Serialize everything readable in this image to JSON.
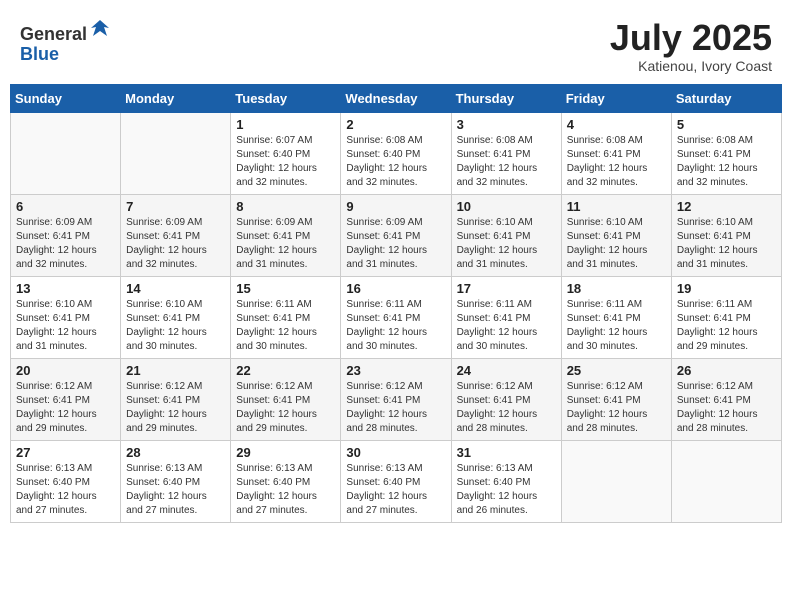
{
  "header": {
    "logo_general": "General",
    "logo_blue": "Blue",
    "month_title": "July 2025",
    "location": "Katienou, Ivory Coast"
  },
  "weekdays": [
    "Sunday",
    "Monday",
    "Tuesday",
    "Wednesday",
    "Thursday",
    "Friday",
    "Saturday"
  ],
  "weeks": [
    [
      {
        "day": "",
        "info": ""
      },
      {
        "day": "",
        "info": ""
      },
      {
        "day": "1",
        "info": "Sunrise: 6:07 AM\nSunset: 6:40 PM\nDaylight: 12 hours and 32 minutes."
      },
      {
        "day": "2",
        "info": "Sunrise: 6:08 AM\nSunset: 6:40 PM\nDaylight: 12 hours and 32 minutes."
      },
      {
        "day": "3",
        "info": "Sunrise: 6:08 AM\nSunset: 6:41 PM\nDaylight: 12 hours and 32 minutes."
      },
      {
        "day": "4",
        "info": "Sunrise: 6:08 AM\nSunset: 6:41 PM\nDaylight: 12 hours and 32 minutes."
      },
      {
        "day": "5",
        "info": "Sunrise: 6:08 AM\nSunset: 6:41 PM\nDaylight: 12 hours and 32 minutes."
      }
    ],
    [
      {
        "day": "6",
        "info": "Sunrise: 6:09 AM\nSunset: 6:41 PM\nDaylight: 12 hours and 32 minutes."
      },
      {
        "day": "7",
        "info": "Sunrise: 6:09 AM\nSunset: 6:41 PM\nDaylight: 12 hours and 32 minutes."
      },
      {
        "day": "8",
        "info": "Sunrise: 6:09 AM\nSunset: 6:41 PM\nDaylight: 12 hours and 31 minutes."
      },
      {
        "day": "9",
        "info": "Sunrise: 6:09 AM\nSunset: 6:41 PM\nDaylight: 12 hours and 31 minutes."
      },
      {
        "day": "10",
        "info": "Sunrise: 6:10 AM\nSunset: 6:41 PM\nDaylight: 12 hours and 31 minutes."
      },
      {
        "day": "11",
        "info": "Sunrise: 6:10 AM\nSunset: 6:41 PM\nDaylight: 12 hours and 31 minutes."
      },
      {
        "day": "12",
        "info": "Sunrise: 6:10 AM\nSunset: 6:41 PM\nDaylight: 12 hours and 31 minutes."
      }
    ],
    [
      {
        "day": "13",
        "info": "Sunrise: 6:10 AM\nSunset: 6:41 PM\nDaylight: 12 hours and 31 minutes."
      },
      {
        "day": "14",
        "info": "Sunrise: 6:10 AM\nSunset: 6:41 PM\nDaylight: 12 hours and 30 minutes."
      },
      {
        "day": "15",
        "info": "Sunrise: 6:11 AM\nSunset: 6:41 PM\nDaylight: 12 hours and 30 minutes."
      },
      {
        "day": "16",
        "info": "Sunrise: 6:11 AM\nSunset: 6:41 PM\nDaylight: 12 hours and 30 minutes."
      },
      {
        "day": "17",
        "info": "Sunrise: 6:11 AM\nSunset: 6:41 PM\nDaylight: 12 hours and 30 minutes."
      },
      {
        "day": "18",
        "info": "Sunrise: 6:11 AM\nSunset: 6:41 PM\nDaylight: 12 hours and 30 minutes."
      },
      {
        "day": "19",
        "info": "Sunrise: 6:11 AM\nSunset: 6:41 PM\nDaylight: 12 hours and 29 minutes."
      }
    ],
    [
      {
        "day": "20",
        "info": "Sunrise: 6:12 AM\nSunset: 6:41 PM\nDaylight: 12 hours and 29 minutes."
      },
      {
        "day": "21",
        "info": "Sunrise: 6:12 AM\nSunset: 6:41 PM\nDaylight: 12 hours and 29 minutes."
      },
      {
        "day": "22",
        "info": "Sunrise: 6:12 AM\nSunset: 6:41 PM\nDaylight: 12 hours and 29 minutes."
      },
      {
        "day": "23",
        "info": "Sunrise: 6:12 AM\nSunset: 6:41 PM\nDaylight: 12 hours and 28 minutes."
      },
      {
        "day": "24",
        "info": "Sunrise: 6:12 AM\nSunset: 6:41 PM\nDaylight: 12 hours and 28 minutes."
      },
      {
        "day": "25",
        "info": "Sunrise: 6:12 AM\nSunset: 6:41 PM\nDaylight: 12 hours and 28 minutes."
      },
      {
        "day": "26",
        "info": "Sunrise: 6:12 AM\nSunset: 6:41 PM\nDaylight: 12 hours and 28 minutes."
      }
    ],
    [
      {
        "day": "27",
        "info": "Sunrise: 6:13 AM\nSunset: 6:40 PM\nDaylight: 12 hours and 27 minutes."
      },
      {
        "day": "28",
        "info": "Sunrise: 6:13 AM\nSunset: 6:40 PM\nDaylight: 12 hours and 27 minutes."
      },
      {
        "day": "29",
        "info": "Sunrise: 6:13 AM\nSunset: 6:40 PM\nDaylight: 12 hours and 27 minutes."
      },
      {
        "day": "30",
        "info": "Sunrise: 6:13 AM\nSunset: 6:40 PM\nDaylight: 12 hours and 27 minutes."
      },
      {
        "day": "31",
        "info": "Sunrise: 6:13 AM\nSunset: 6:40 PM\nDaylight: 12 hours and 26 minutes."
      },
      {
        "day": "",
        "info": ""
      },
      {
        "day": "",
        "info": ""
      }
    ]
  ]
}
